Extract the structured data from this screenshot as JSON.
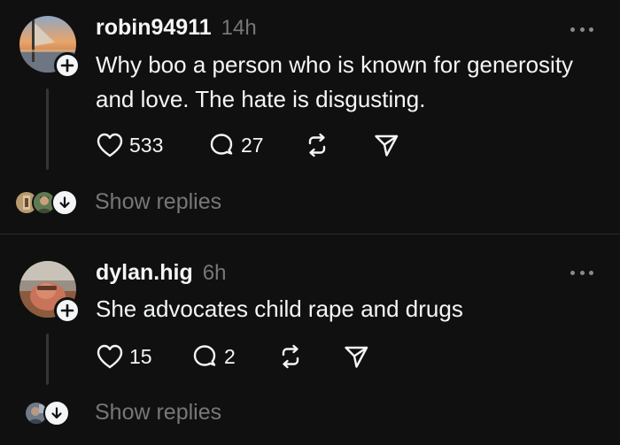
{
  "posts": [
    {
      "username": "robin94911",
      "time": "14h",
      "text": "Why boo a person who is known for generosity and love. The hate is disgusting.",
      "likes": "533",
      "comments": "27",
      "show_replies": "Show replies"
    },
    {
      "username": "dylan.hig",
      "time": "6h",
      "text": "She advocates child rape and drugs",
      "likes": "15",
      "comments": "2",
      "show_replies": "Show replies"
    }
  ],
  "icons": {
    "like": "heart-icon",
    "comment": "comment-bubble-icon",
    "repost": "repost-icon",
    "share": "send-icon",
    "more": "more-options-icon",
    "follow": "plus-icon",
    "expand": "arrow-down-icon"
  },
  "colors": {
    "background": "#101010",
    "primary_text": "#f3f5f7",
    "secondary_text": "#777777",
    "divider": "#2a2a2a"
  }
}
